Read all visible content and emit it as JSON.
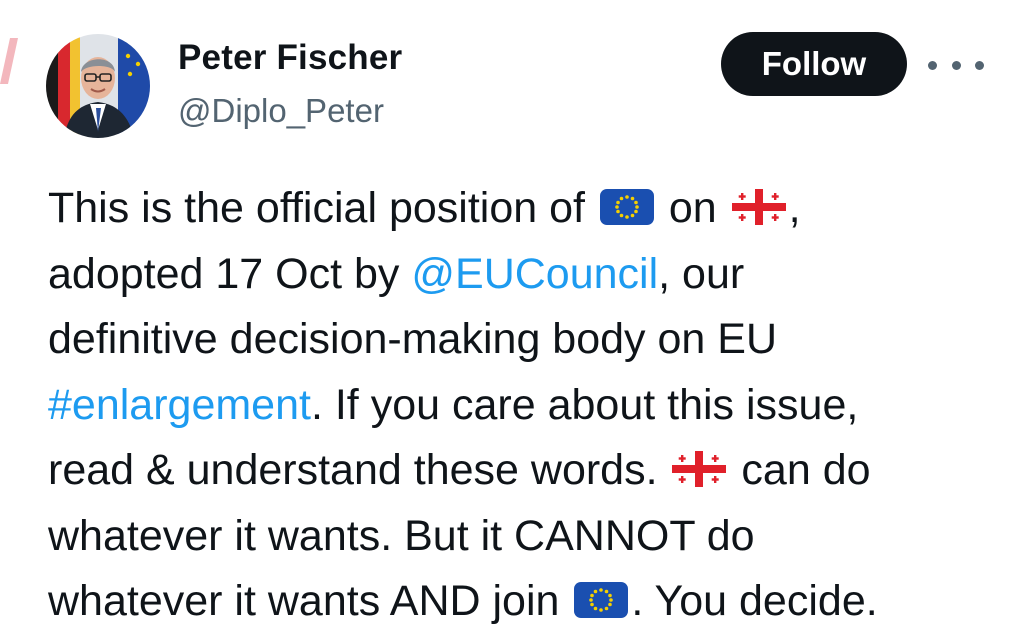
{
  "author": {
    "display_name": "Peter Fischer",
    "handle": "@Diplo_Peter"
  },
  "actions": {
    "follow_label": "Follow",
    "more_icon": "more-horizontal-icon"
  },
  "tweet": {
    "segments": {
      "l1_a": "This is the official position of ",
      "l1_b": " on ",
      "l1_c": ",",
      "l2_a": "adopted 17 Oct by ",
      "l2_mention": "@EUCouncil",
      "l2_b": ", our",
      "l3": "definitive decision-making body on EU",
      "l4_hashtag": "#enlargement",
      "l4_b": ". If you care about this issue,",
      "l5_a": "read & understand these words. ",
      "l5_b": " can do",
      "l6": "whatever it wants. But it CANNOT do",
      "l7_a": "whatever it wants AND join ",
      "l7_b": ". You decide."
    },
    "emoji": {
      "eu_flag": "eu-flag-icon",
      "georgia_flag": "georgia-flag-icon"
    }
  },
  "colors": {
    "text": "#0f1419",
    "secondary": "#536471",
    "link": "#1d9bf0",
    "button_bg": "#0f1419",
    "button_text": "#ffffff"
  }
}
